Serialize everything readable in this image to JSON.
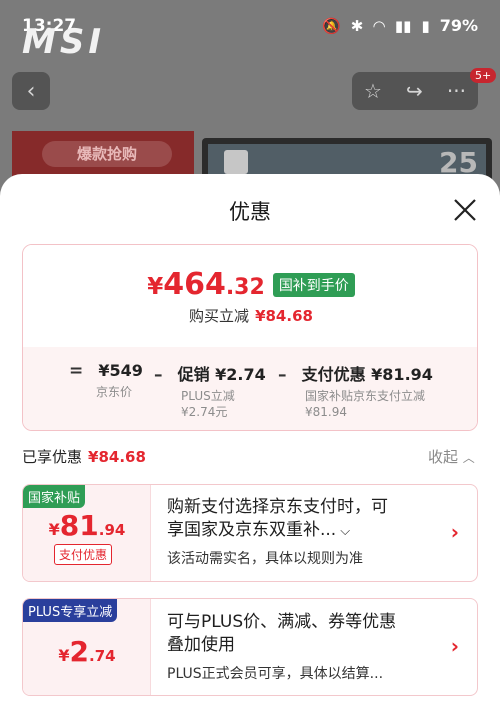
{
  "status_bar": {
    "time": "13:27",
    "battery": "79%",
    "icons": [
      "mute-icon",
      "bluetooth-icon",
      "wifi-icon",
      "signal-5g-icon",
      "battery-icon"
    ]
  },
  "background_page": {
    "brand_logo": "MSI",
    "promo_label": "爆款抢购",
    "monitor_number": "25",
    "notification_badge": "5+"
  },
  "sheet": {
    "title": "优惠",
    "summary": {
      "final_price_yen": "¥",
      "final_price_int": "464",
      "final_price_dec": ".32",
      "final_price_tag": "国补到手价",
      "reduce_label": "购买立减",
      "reduce_amount": "¥84.68",
      "formula": [
        {
          "op": "=",
          "value": "¥549",
          "sub1": "京东价",
          "sub2": ""
        },
        {
          "op": "–",
          "value": "促销 ¥2.74",
          "sub1": "PLUS立减",
          "sub2": "¥2.74元"
        },
        {
          "op": "–",
          "value": "支付优惠 ¥81.94",
          "sub1": "国家补贴京东支付立减",
          "sub2": "¥81.94"
        }
      ]
    },
    "enjoyed_label": "已享优惠",
    "enjoyed_amount": "¥84.68",
    "collapse_label": "收起",
    "cards": [
      {
        "badge": "国家补贴",
        "amount_yen": "¥",
        "amount_int": "81",
        "amount_dec": ".94",
        "pay_tag": "支付优惠",
        "desc_line1": "购新支付选择京东支付时，可",
        "desc_line2": "享国家及京东双重补...",
        "note": "该活动需实名，具体以规则为准"
      },
      {
        "badge": "PLUS专享立减",
        "amount_yen": "¥",
        "amount_int": "2",
        "amount_dec": ".74",
        "desc_line1": "可与PLUS价、满减、券等优惠",
        "desc_line2": "叠加使用",
        "note": "PLUS正式会员可享，具体以结算..."
      }
    ]
  },
  "colors": {
    "accent_red": "#e4262f",
    "green_tag": "#2f9d55",
    "plus_blue": "#2a3f9c"
  }
}
